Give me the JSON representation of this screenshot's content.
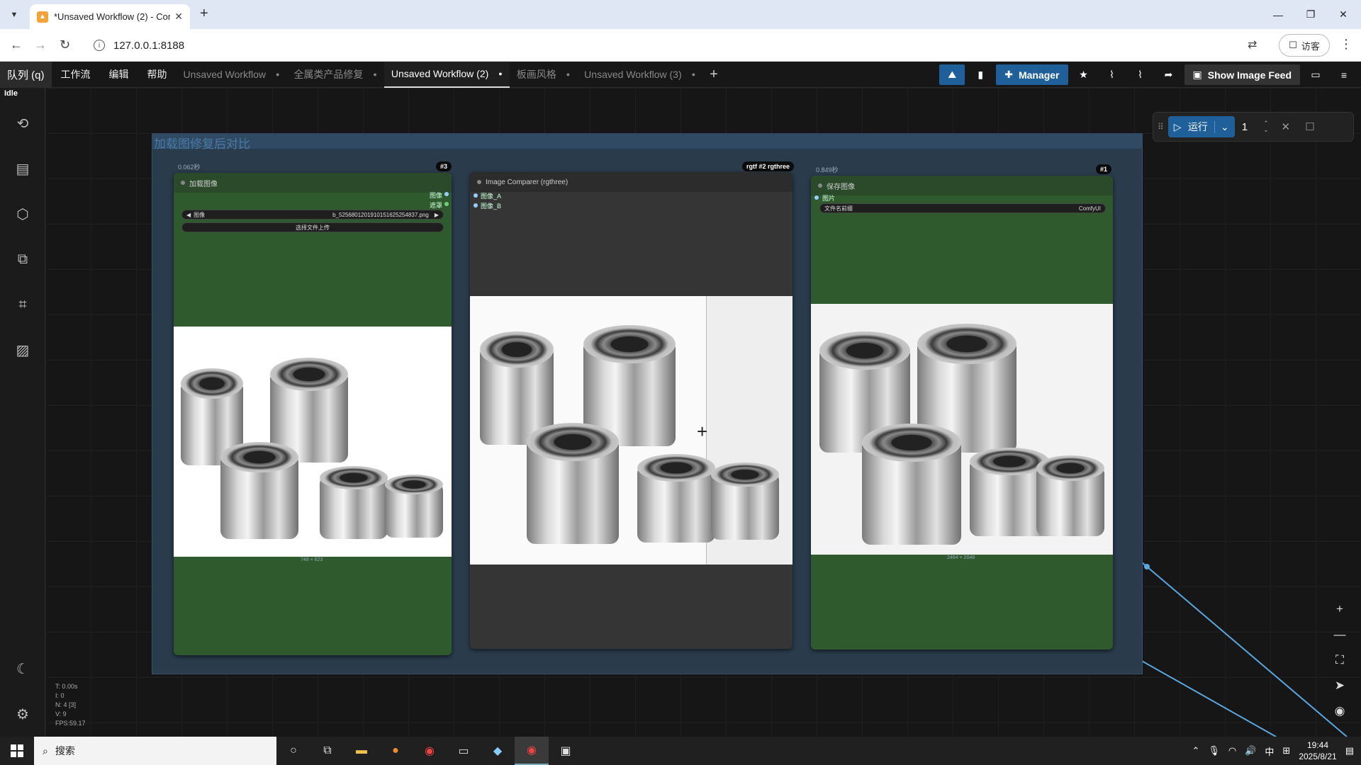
{
  "browser": {
    "tab_title": "*Unsaved Workflow (2) - Con",
    "url": "127.0.0.1:8188",
    "profile_label": "访客"
  },
  "menu": {
    "queue": "队列 (q)",
    "items": [
      "工作流",
      "编辑",
      "帮助"
    ],
    "workflow_tabs": [
      {
        "label": "Unsaved Workflow",
        "active": false
      },
      {
        "label": "全属类产品修复",
        "active": false
      },
      {
        "label": "Unsaved Workflow (2)",
        "active": true
      },
      {
        "label": "板画风格",
        "active": false
      },
      {
        "label": "Unsaved Workflow (3)",
        "active": false
      }
    ],
    "manager_label": "Manager",
    "show_image_feed_label": "Show Image Feed",
    "status": "Idle"
  },
  "group": {
    "title": "加载图修复后对比"
  },
  "nodes": {
    "load_image": {
      "time": "0.062秒",
      "id": "#3",
      "title": "加载图像",
      "outputs": [
        "图像",
        "遮罩"
      ],
      "image_label": "图像",
      "image_value": "b_5256801201910151625254837.png",
      "upload_label": "选择文件上传",
      "size": "749 × 623"
    },
    "comparer": {
      "badge": "rgtf #2 rgthree",
      "title": "Image Comparer (rgthree)",
      "inputs": [
        "图像_A",
        "图像_B"
      ]
    },
    "save_image": {
      "time": "0.849秒",
      "id": "#1",
      "title": "保存图像",
      "input": "图片",
      "prefix_label": "文件名前缀",
      "prefix_value": "ComfyUI",
      "size": "2464 × 2048"
    }
  },
  "runbar": {
    "run_label": "运行",
    "count": "1"
  },
  "stats": [
    "T: 0.00s",
    "I: 0",
    "N: 4 [3]",
    "V: 9",
    "FPS:59.17"
  ],
  "taskbar": {
    "search_placeholder": "搜索",
    "ime": "中",
    "time": "19:44",
    "date": "2025/8/21"
  },
  "colors": {
    "accent": "#1f5f9a",
    "node_body": "#2e5a2e",
    "group": "#2a3b4c"
  }
}
